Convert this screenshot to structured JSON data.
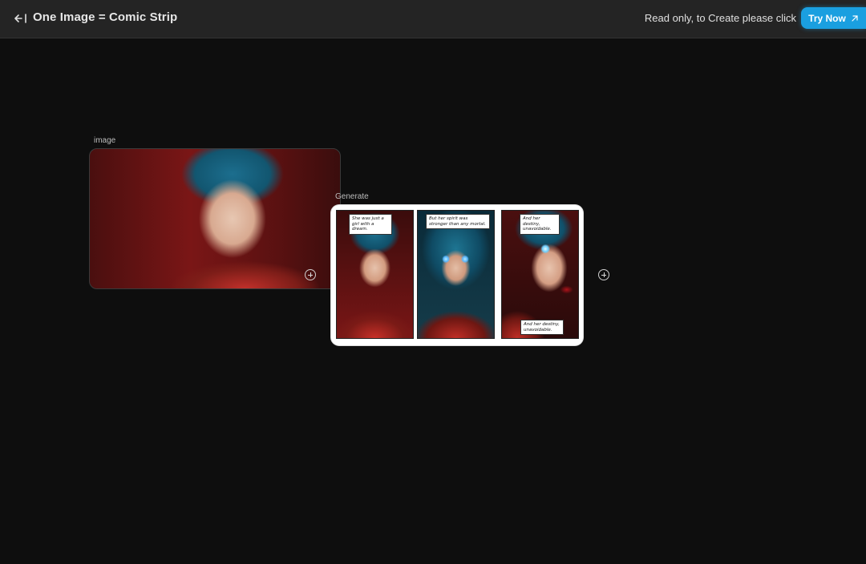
{
  "header": {
    "back_icon": "back-arrow-icon",
    "title": "One Image = Comic Strip",
    "readonly_text": "Read only, to Create please click",
    "try_now_label": "Try Now",
    "try_now_icon": "arrow-up-right-icon",
    "accent_color": "#1a9fe0"
  },
  "canvas": {
    "image_node": {
      "label": "image"
    },
    "generate_node": {
      "label": "Generate",
      "panels": [
        {
          "caption_top": "She was just a girl with a dream."
        },
        {
          "caption_top": "But her spirit was stronger than any mortal."
        },
        {
          "caption_top": "And her destiny, unavoidable.",
          "caption_bottom": "And her destiny, unavoidable."
        }
      ]
    }
  }
}
